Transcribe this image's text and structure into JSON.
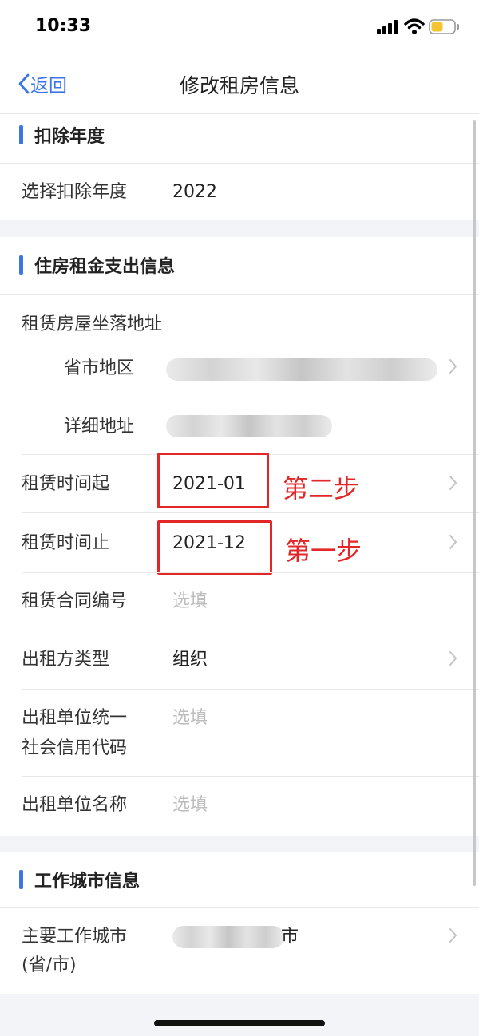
{
  "status_bar": {
    "time": "10:33"
  },
  "nav": {
    "back_label": "返回",
    "title": "修改租房信息"
  },
  "section_deduction": {
    "title": "扣除年度",
    "year_label": "选择扣除年度",
    "year_value": "2022"
  },
  "section_rent": {
    "title": "住房租金支出信息",
    "address_label": "租赁房屋坐落地址",
    "region_label": "省市地区",
    "detail_label": "详细地址",
    "start_label": "租赁时间起",
    "start_value": "2021-01",
    "start_annotation": "第二步",
    "end_label": "租赁时间止",
    "end_value": "2021-12",
    "end_annotation": "第一步",
    "contract_label": "租赁合同编号",
    "contract_placeholder": "选填",
    "lessor_type_label": "出租方类型",
    "lessor_type_value": "组织",
    "credit_code_label_1": "出租单位统一",
    "credit_code_label_2": "社会信用代码",
    "credit_code_placeholder": "选填",
    "lessor_name_label": "出租单位名称",
    "lessor_name_placeholder": "选填"
  },
  "section_city": {
    "title": "工作城市信息",
    "city_label_1": "主要工作城市",
    "city_label_2": "(省/市)",
    "city_value_suffix": "市"
  },
  "colors": {
    "accent": "#3b76e6",
    "annotation": "#e32626"
  }
}
